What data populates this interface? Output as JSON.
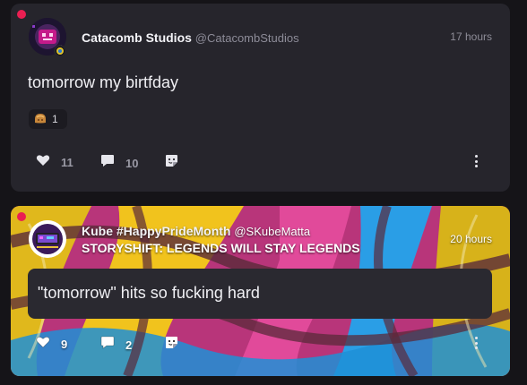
{
  "posts": [
    {
      "author": "Catacomb Studios",
      "handle": "@CatacombStudios",
      "time": "17 hours",
      "text": "tomorrow my birtfday",
      "reaction": {
        "icon": "bread-emoji-icon",
        "count": "1"
      },
      "likes": "11",
      "comments": "10"
    },
    {
      "author": "Kube #HappyPrideMonth",
      "handle": "@SKubeMatta",
      "subtitle": "STORYSHIFT: LEGENDS WILL STAY LEGENDS",
      "time": "20 hours",
      "text": "\"tomorrow\" hits so fucking hard",
      "likes": "9",
      "comments": "2"
    }
  ],
  "colors": {
    "unread": "#ea1f52",
    "card": "#26252c",
    "background": "#151418"
  }
}
